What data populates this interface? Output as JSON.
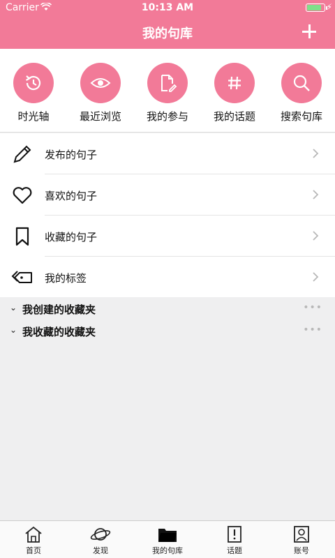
{
  "status_bar": {
    "carrier": "Carrier",
    "time": "10:13 AM",
    "battery_level": 0.85
  },
  "header": {
    "title": "我的句库"
  },
  "quick_actions": [
    {
      "label": "时光轴",
      "icon": "history-icon"
    },
    {
      "label": "最近浏览",
      "icon": "eye-icon"
    },
    {
      "label": "我的参与",
      "icon": "edit-document-icon"
    },
    {
      "label": "我的话题",
      "icon": "hashtag-icon"
    },
    {
      "label": "搜索句库",
      "icon": "search-icon"
    }
  ],
  "menu": [
    {
      "label": "发布的句子",
      "icon": "pencil-icon"
    },
    {
      "label": "喜欢的句子",
      "icon": "heart-icon"
    },
    {
      "label": "收藏的句子",
      "icon": "bookmark-icon"
    },
    {
      "label": "我的标签",
      "icon": "tags-icon"
    }
  ],
  "folders": [
    {
      "label": "我创建的收藏夹",
      "more": "•••"
    },
    {
      "label": "我收藏的收藏夹",
      "more": "•••"
    }
  ],
  "tabs": [
    {
      "label": "首页",
      "icon": "home-icon",
      "active": false
    },
    {
      "label": "发现",
      "icon": "planet-icon",
      "active": false
    },
    {
      "label": "我的句库",
      "icon": "folder-icon",
      "active": true
    },
    {
      "label": "话题",
      "icon": "topic-book-icon",
      "active": false
    },
    {
      "label": "账号",
      "icon": "account-icon",
      "active": false
    }
  ],
  "colors": {
    "accent": "#f27a98",
    "background": "#efeff0"
  }
}
